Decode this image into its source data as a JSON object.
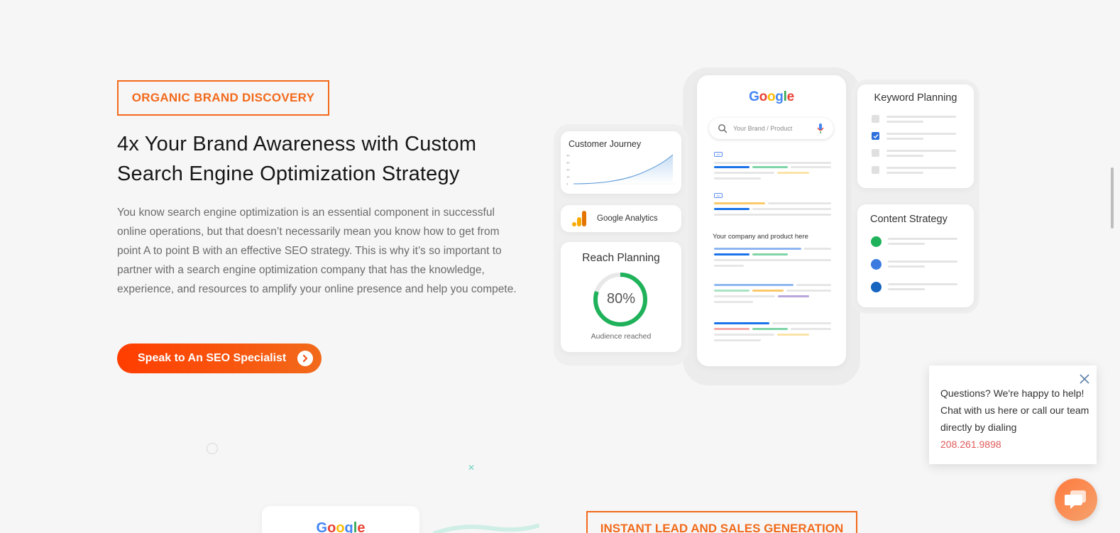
{
  "section": {
    "badge": "ORGANIC BRAND DISCOVERY",
    "headline_line1": "4x Your Brand Awareness with Custom",
    "headline_line2": "Search Engine Optimization Strategy",
    "body": "You know search engine optimization is an essential component in successful online operations, but that doesn’t necessarily mean you know how to get from point A to point B with an effective SEO strategy. This is why it’s so important to partner with a search engine optimization company that has the knowledge, experience, and resources to amplify your online presence and help you compete.",
    "cta_label": "Speak to An SEO Specialist",
    "cta_icon": "chevron-right-icon"
  },
  "illustration": {
    "phone": {
      "logo": "Google",
      "search_placeholder": "Your Brand / Product",
      "ad_label": "Ad",
      "company_text": "Your company and product here"
    },
    "customer_journey": {
      "title": "Customer Journey",
      "y_ticks": [
        "4K",
        "3K",
        "2K",
        "1K",
        "0"
      ]
    },
    "analytics": {
      "label": "Google Analytics"
    },
    "reach_planning": {
      "title": "Reach Planning",
      "percent_label": "80%",
      "percent_value": 0.8,
      "caption": "Audience reached"
    },
    "keyword_planning": {
      "title": "Keyword Planning",
      "checked": [
        false,
        true,
        false,
        false
      ]
    },
    "content_strategy": {
      "title": "Content Strategy",
      "dot_colors": [
        "#1fb25a",
        "#3b7be0",
        "#1565c0"
      ]
    }
  },
  "chat": {
    "message": "Questions? We're happy to help! Chat with us here or call our team directly by dialing",
    "phone": "208.261.9898"
  },
  "next_section": {
    "card_logo": "Google",
    "badge": "INSTANT LEAD AND SALES GENERATION"
  },
  "colors": {
    "accent": "#f26a1b",
    "cta_start": "#ff3d00",
    "progress": "#1fb25a"
  }
}
